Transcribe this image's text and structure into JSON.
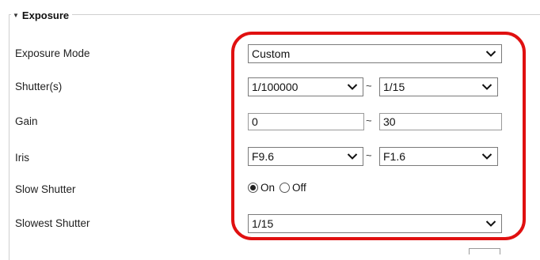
{
  "section": {
    "title": "Exposure",
    "collapse_icon": "triangle-down-icon"
  },
  "labels": {
    "exposure_mode": "Exposure Mode",
    "shutter": "Shutter(s)",
    "gain": "Gain",
    "iris": "Iris",
    "slow_shutter": "Slow Shutter",
    "slowest_shutter": "Slowest Shutter"
  },
  "fields": {
    "exposure_mode": "Custom",
    "shutter_min": "1/100000",
    "shutter_max": "1/15",
    "gain_min": "0",
    "gain_max": "30",
    "iris_min": "F9.6",
    "iris_max": "F1.6",
    "slowest_shutter": "1/15"
  },
  "range_separator": "~",
  "slow_shutter": {
    "options": [
      "On",
      "Off"
    ],
    "selected": "On"
  },
  "colors": {
    "highlight": "#e01010"
  }
}
